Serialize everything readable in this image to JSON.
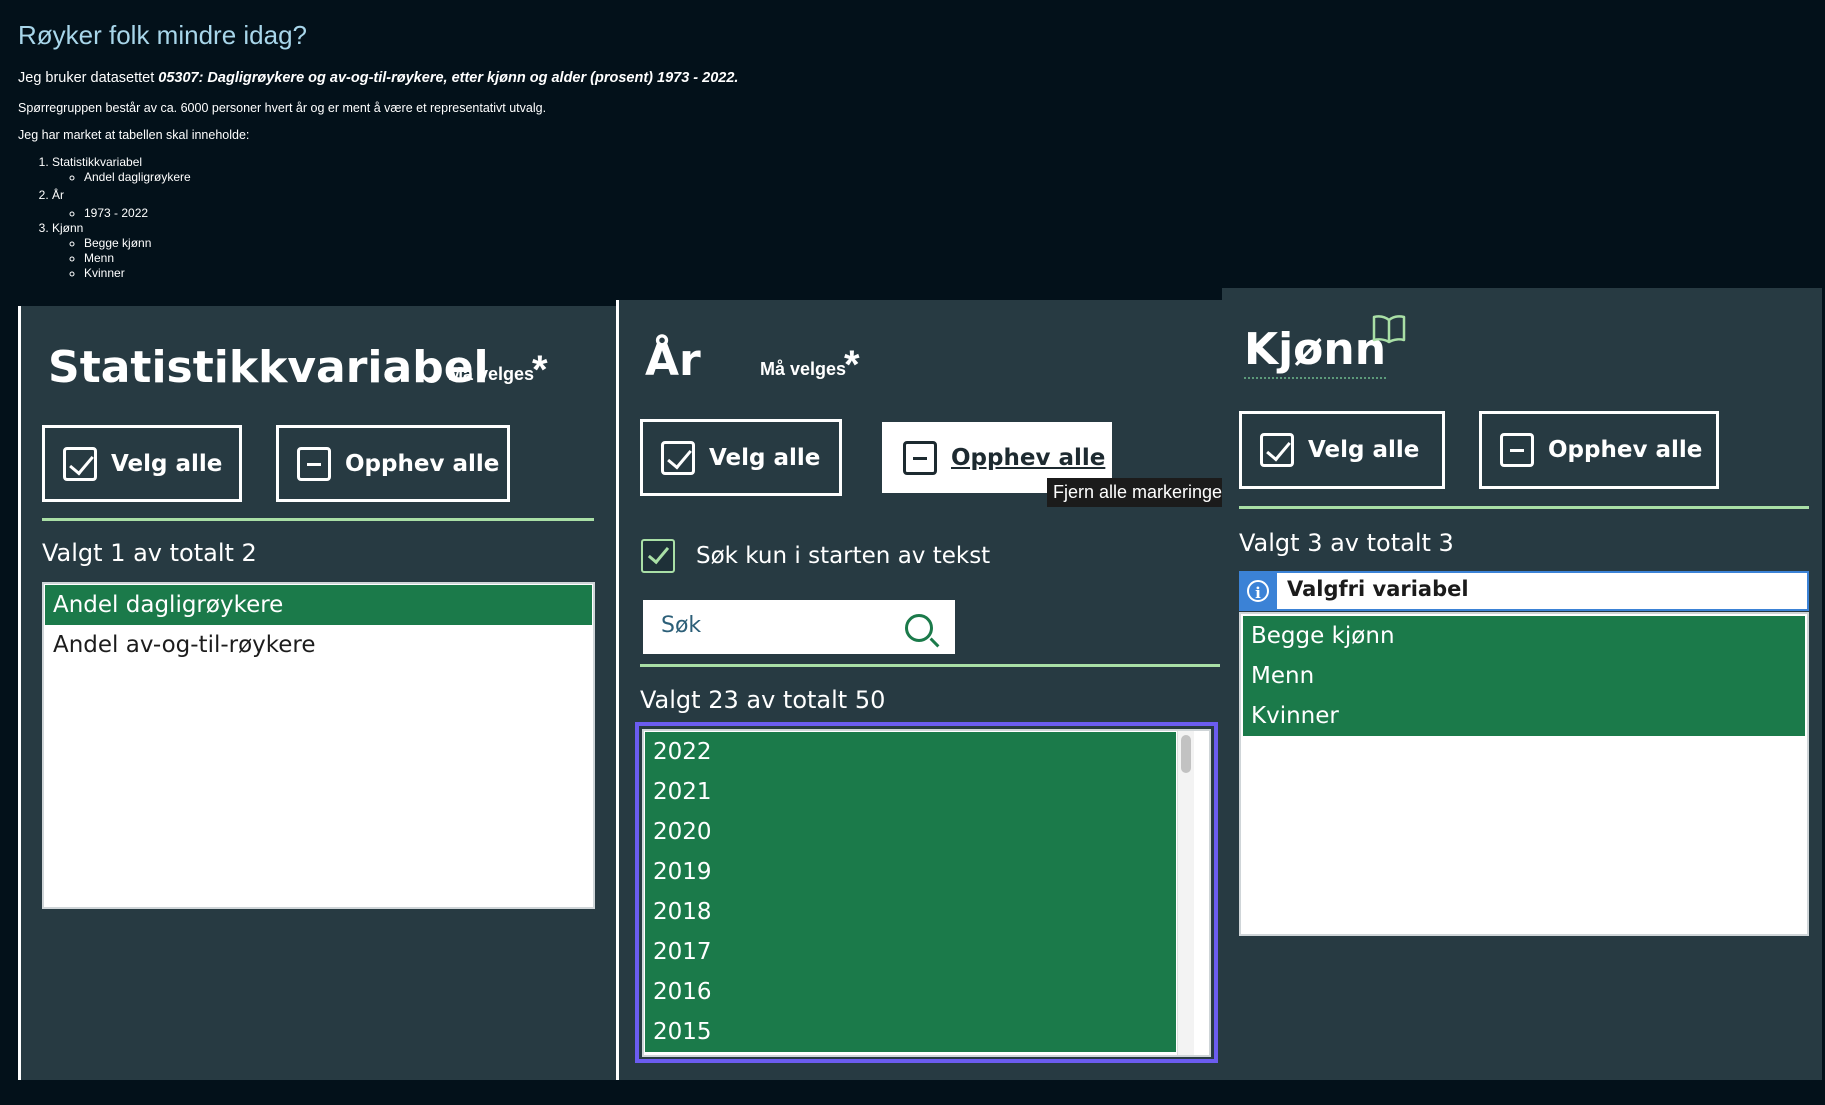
{
  "intro": {
    "title": "Røyker folk mindre idag?",
    "dataset_prefix": "Jeg bruker datasettet ",
    "dataset_name": "05307: Dagligrøykere og av-og-til-røykere, etter kjønn og alder (prosent) 1973 - 2022.",
    "description": "Spørregruppen består av ca. 6000 personer hvert år og er ment å være et representativt utvalg.",
    "list_intro": "Jeg har market at tabellen skal inneholde:",
    "items": [
      {
        "label": "Statistikkvariabel",
        "sub": [
          "Andel dagligrøykere"
        ]
      },
      {
        "label": "År",
        "sub": [
          "1973 - 2022"
        ]
      },
      {
        "label": "Kjønn",
        "sub": [
          "Begge kjønn",
          "Menn",
          "Kvinner"
        ]
      }
    ]
  },
  "common": {
    "select_all": "Velg alle",
    "deselect_all": "Opphev alle",
    "required": "Må velges",
    "star": "*"
  },
  "statistikk": {
    "title": "Statistikkvariabel",
    "count": "Valgt 1 av totalt 2",
    "options": [
      {
        "label": "Andel dagligrøykere",
        "selected": true
      },
      {
        "label": "Andel av-og-til-røykere",
        "selected": false
      }
    ]
  },
  "aar": {
    "title": "År",
    "tooltip": "Fjern alle markeringer",
    "search_start_label": "Søk kun i starten av tekst",
    "search_placeholder": "Søk",
    "count": "Valgt 23 av totalt 50",
    "options": [
      "2022",
      "2021",
      "2020",
      "2019",
      "2018",
      "2017",
      "2016",
      "2015"
    ]
  },
  "kjonn": {
    "title": "Kjønn",
    "count": "Valgt 3 av totalt 3",
    "info": "Valgfri variabel",
    "options": [
      "Begge kjønn",
      "Menn",
      "Kvinner"
    ]
  },
  "colors": {
    "background": "#03111a",
    "panel": "#273a42",
    "selected": "#1b7a4a",
    "accent_rule": "#a9dfa6",
    "focus": "#6b5cf0",
    "info": "#3b82d6"
  }
}
